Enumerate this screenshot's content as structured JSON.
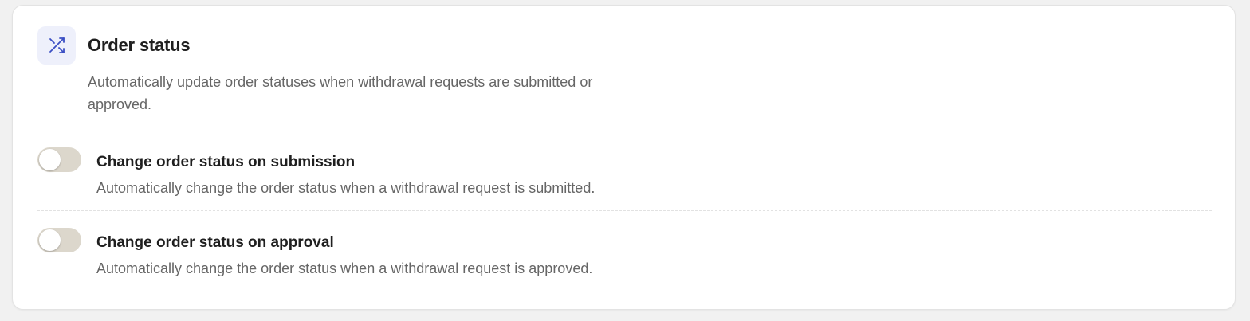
{
  "section": {
    "icon": "shuffle-icon",
    "title": "Order status",
    "description": "Automatically update order statuses when withdrawal requests are submitted or approved."
  },
  "settings": [
    {
      "label": "Change order status on submission",
      "description": "Automatically change the order status when a withdrawal request is submitted.",
      "enabled": false
    },
    {
      "label": "Change order status on approval",
      "description": "Automatically change the order status when a withdrawal request is approved.",
      "enabled": false
    }
  ],
  "colors": {
    "icon_background": "#eef0fb",
    "icon_color": "#3b4fc4",
    "toggle_off": "#dcd7cc",
    "title_text": "#1f1f1f",
    "description_text": "#666666"
  }
}
